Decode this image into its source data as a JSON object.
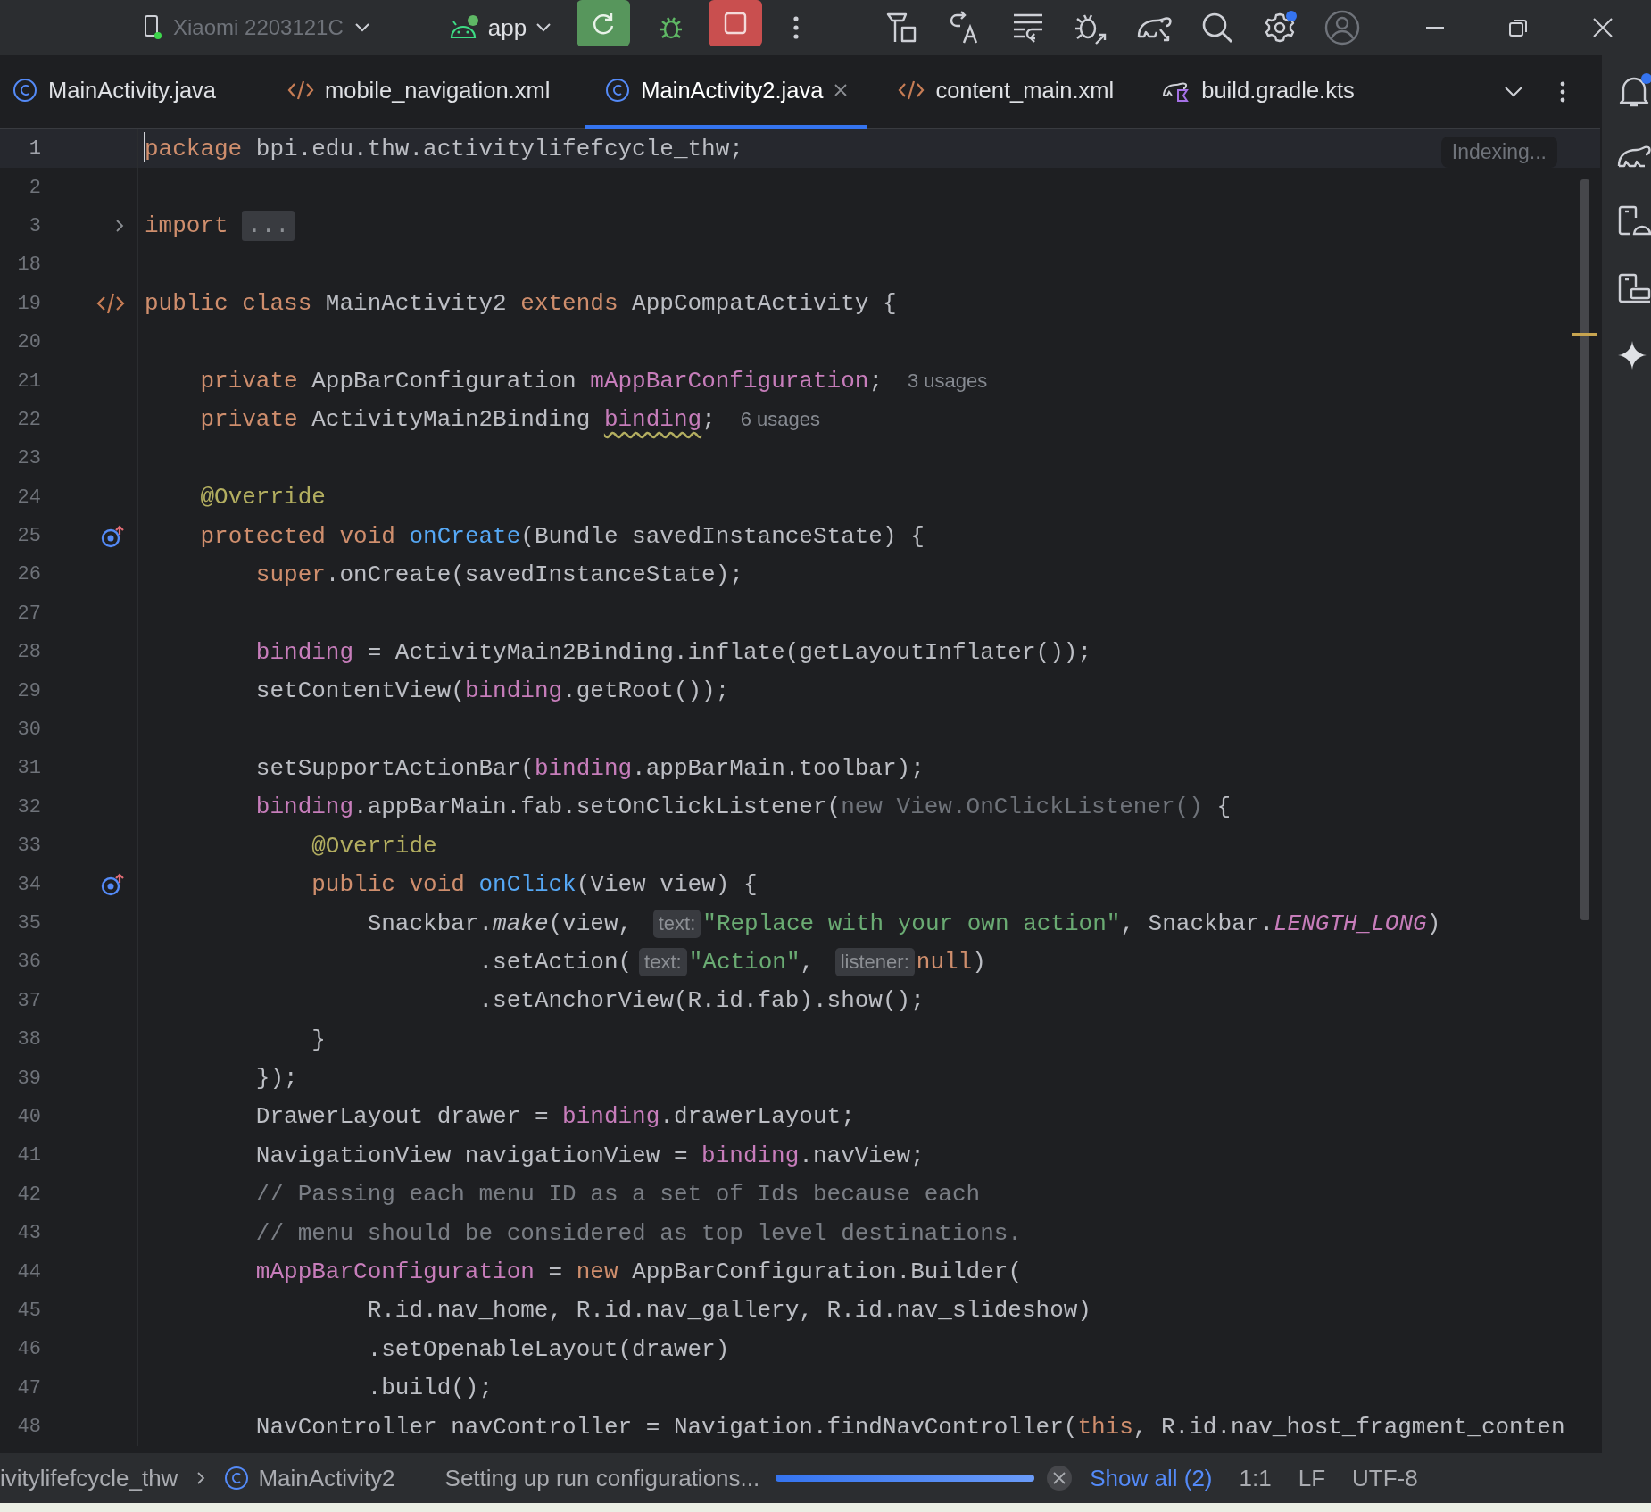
{
  "toolbar": {
    "device": {
      "label": "Xiaomi 2203121C",
      "disabled": true
    },
    "run_config": "app"
  },
  "tabs": [
    {
      "label": "MainActivity.java",
      "kind": "java",
      "selected": false
    },
    {
      "label": "mobile_navigation.xml",
      "kind": "xml",
      "selected": false
    },
    {
      "label": "MainActivity2.java",
      "kind": "java",
      "selected": true
    },
    {
      "label": "content_main.xml",
      "kind": "xml",
      "selected": false
    },
    {
      "label": "build.gradle.kts",
      "kind": "gradle",
      "selected": false
    }
  ],
  "editor": {
    "indexing": "Indexing...",
    "lines": [
      {
        "number": "1",
        "current": true,
        "tokens": [
          {
            "kind": "keyword",
            "text": "package"
          },
          {
            "kind": "plain",
            "text": " bpi.edu.thw.activitylifefcycle_thw;"
          }
        ]
      },
      {
        "number": "2",
        "current": false
      },
      {
        "number": "3",
        "current": false,
        "gutter": {
          "kind": "fold"
        },
        "tokens": [
          {
            "kind": "keyword",
            "text": "import "
          },
          {
            "kind": "fold",
            "text": "..."
          }
        ]
      },
      {
        "number": "18",
        "current": false
      },
      {
        "number": "19",
        "current": false,
        "gutter": {
          "kind": "xml"
        },
        "tokens": [
          {
            "kind": "keyword",
            "text": "public class "
          },
          {
            "kind": "plain",
            "text": "MainActivity2 "
          },
          {
            "kind": "keyword",
            "text": "extends "
          },
          {
            "kind": "plain",
            "text": "AppCompatActivity {"
          }
        ]
      },
      {
        "number": "20",
        "current": false
      },
      {
        "number": "21",
        "current": false,
        "tokens": [
          {
            "kind": "keyword",
            "text": "    private "
          },
          {
            "kind": "plain",
            "text": "AppBarConfiguration "
          },
          {
            "kind": "field",
            "text": "mAppBarConfiguration"
          },
          {
            "kind": "plain",
            "text": ";"
          },
          {
            "kind": "usages",
            "text": "3 usages"
          }
        ]
      },
      {
        "number": "22",
        "current": false,
        "tokens": [
          {
            "kind": "keyword",
            "text": "    private "
          },
          {
            "kind": "plain",
            "text": "ActivityMain2Binding "
          },
          {
            "kind": "field",
            "text": "binding",
            "warning": true
          },
          {
            "kind": "plain",
            "text": ";"
          },
          {
            "kind": "usages",
            "text": "6 usages"
          }
        ]
      },
      {
        "number": "23",
        "current": false
      },
      {
        "number": "24",
        "current": false,
        "tokens": [
          {
            "kind": "annotation",
            "text": "    @Override"
          }
        ]
      },
      {
        "number": "25",
        "current": false,
        "gutter": {
          "kind": "override"
        },
        "tokens": [
          {
            "kind": "keyword",
            "text": "    protected void "
          },
          {
            "kind": "method",
            "text": "onCreate"
          },
          {
            "kind": "plain",
            "text": "(Bundle savedInstanceState) {"
          }
        ]
      },
      {
        "number": "26",
        "current": false,
        "tokens": [
          {
            "kind": "keyword",
            "text": "        super"
          },
          {
            "kind": "plain",
            "text": ".onCreate(savedInstanceState);"
          }
        ]
      },
      {
        "number": "27",
        "current": false
      },
      {
        "number": "28",
        "current": false,
        "tokens": [
          {
            "kind": "field",
            "text": "        binding"
          },
          {
            "kind": "plain",
            "text": " = ActivityMain2Binding.inflate(getLayoutInflater());"
          }
        ]
      },
      {
        "number": "29",
        "current": false,
        "tokens": [
          {
            "kind": "plain",
            "text": "        setContentView("
          },
          {
            "kind": "field",
            "text": "binding"
          },
          {
            "kind": "plain",
            "text": ".getRoot());"
          }
        ]
      },
      {
        "number": "30",
        "current": false
      },
      {
        "number": "31",
        "current": false,
        "tokens": [
          {
            "kind": "plain",
            "text": "        setSupportActionBar("
          },
          {
            "kind": "field",
            "text": "binding"
          },
          {
            "kind": "plain",
            "text": ".appBarMain.toolbar);"
          }
        ]
      },
      {
        "number": "32",
        "current": false,
        "tokens": [
          {
            "kind": "field",
            "text": "        binding"
          },
          {
            "kind": "plain",
            "text": ".appBarMain.fab.setOnClickListener("
          },
          {
            "kind": "dim",
            "text": "new View.OnClickListener()"
          },
          {
            "kind": "plain",
            "text": " {"
          }
        ]
      },
      {
        "number": "33",
        "current": false,
        "tokens": [
          {
            "kind": "annotation",
            "text": "            @Override"
          }
        ]
      },
      {
        "number": "34",
        "current": false,
        "gutter": {
          "kind": "override"
        },
        "tokens": [
          {
            "kind": "keyword",
            "text": "            public void "
          },
          {
            "kind": "method",
            "text": "onClick"
          },
          {
            "kind": "plain",
            "text": "(View view) {"
          }
        ]
      },
      {
        "number": "35",
        "current": false,
        "tokens": [
          {
            "kind": "plain",
            "text": "                Snackbar."
          },
          {
            "kind": "static_method",
            "text": "make"
          },
          {
            "kind": "plain",
            "text": "(view, "
          },
          {
            "kind": "hint",
            "text": "text:"
          },
          {
            "kind": "string",
            "text": "\"Replace with your own action\""
          },
          {
            "kind": "plain",
            "text": ", Snackbar."
          },
          {
            "kind": "static_field",
            "text": "LENGTH_LONG"
          },
          {
            "kind": "plain",
            "text": ")"
          }
        ]
      },
      {
        "number": "36",
        "current": false,
        "tokens": [
          {
            "kind": "plain",
            "text": "                        .setAction("
          },
          {
            "kind": "hint",
            "text": "text:"
          },
          {
            "kind": "string",
            "text": "\"Action\""
          },
          {
            "kind": "plain",
            "text": ", "
          },
          {
            "kind": "hint",
            "text": "listener:"
          },
          {
            "kind": "keyword",
            "text": "null"
          },
          {
            "kind": "plain",
            "text": ")"
          }
        ]
      },
      {
        "number": "37",
        "current": false,
        "tokens": [
          {
            "kind": "plain",
            "text": "                        .setAnchorView(R.id.fab).show();"
          }
        ]
      },
      {
        "number": "38",
        "current": false,
        "tokens": [
          {
            "kind": "plain",
            "text": "            }"
          }
        ]
      },
      {
        "number": "39",
        "current": false,
        "tokens": [
          {
            "kind": "plain",
            "text": "        });"
          }
        ]
      },
      {
        "number": "40",
        "current": false,
        "tokens": [
          {
            "kind": "plain",
            "text": "        DrawerLayout drawer = "
          },
          {
            "kind": "field",
            "text": "binding"
          },
          {
            "kind": "plain",
            "text": ".drawerLayout;"
          }
        ]
      },
      {
        "number": "41",
        "current": false,
        "tokens": [
          {
            "kind": "plain",
            "text": "        NavigationView navigationView = "
          },
          {
            "kind": "field",
            "text": "binding"
          },
          {
            "kind": "plain",
            "text": ".navView;"
          }
        ]
      },
      {
        "number": "42",
        "current": false,
        "tokens": [
          {
            "kind": "comment",
            "text": "        // Passing each menu ID as a set of Ids because each"
          }
        ]
      },
      {
        "number": "43",
        "current": false,
        "tokens": [
          {
            "kind": "comment",
            "text": "        // menu should be considered as top level destinations."
          }
        ]
      },
      {
        "number": "44",
        "current": false,
        "tokens": [
          {
            "kind": "field",
            "text": "        mAppBarConfiguration"
          },
          {
            "kind": "plain",
            "text": " = "
          },
          {
            "kind": "keyword",
            "text": "new "
          },
          {
            "kind": "plain",
            "text": "AppBarConfiguration.Builder("
          }
        ]
      },
      {
        "number": "45",
        "current": false,
        "tokens": [
          {
            "kind": "plain",
            "text": "                R.id.nav_home, R.id.nav_gallery, R.id.nav_slideshow)"
          }
        ]
      },
      {
        "number": "46",
        "current": false,
        "tokens": [
          {
            "kind": "plain",
            "text": "                .setOpenableLayout(drawer)"
          }
        ]
      },
      {
        "number": "47",
        "current": false,
        "tokens": [
          {
            "kind": "plain",
            "text": "                .build();"
          }
        ]
      },
      {
        "number": "48",
        "current": false,
        "tokens": [
          {
            "kind": "plain",
            "text": "        NavController navController = Navigation.findNavController("
          },
          {
            "kind": "keyword",
            "text": "this"
          },
          {
            "kind": "plain",
            "text": ", R.id.nav_host_fragment_conten"
          }
        ]
      }
    ]
  },
  "status_bar": {
    "breadcrumbs": [
      "ivitylifefcycle_thw",
      "MainActivity2"
    ],
    "task": "Setting up run configurations...",
    "progress": {
      "level": 1
    },
    "show_all": "Show all (2)",
    "position": "1:1",
    "line_separator": "LF",
    "encoding": "UTF-8"
  }
}
